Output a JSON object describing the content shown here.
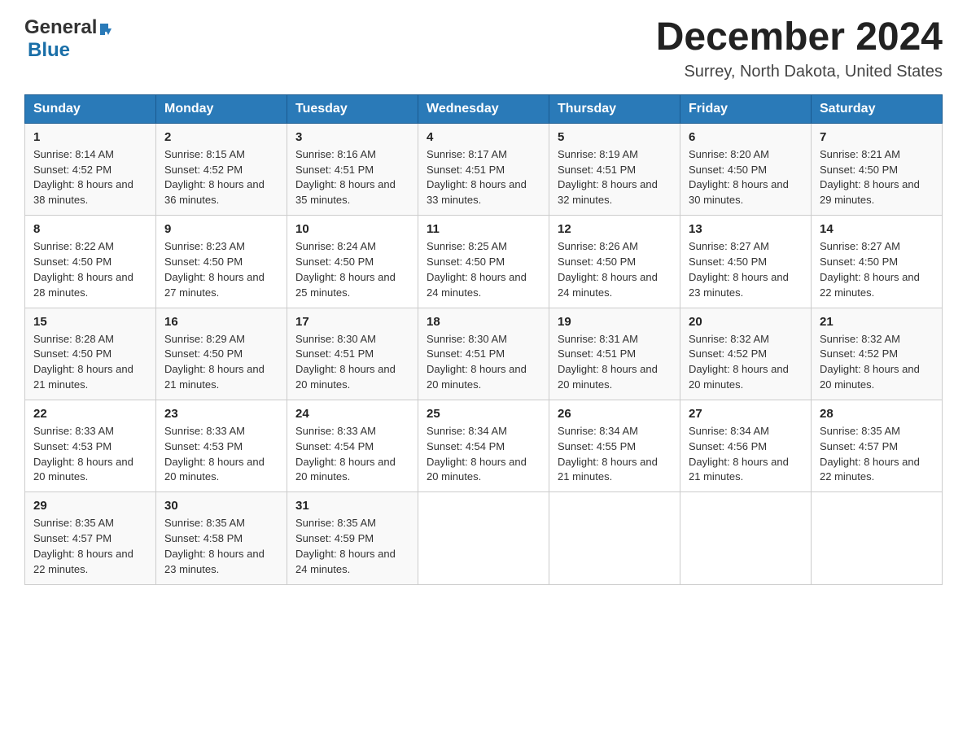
{
  "header": {
    "logo_general": "General",
    "logo_blue": "Blue",
    "month": "December 2024",
    "location": "Surrey, North Dakota, United States"
  },
  "days_of_week": [
    "Sunday",
    "Monday",
    "Tuesday",
    "Wednesday",
    "Thursday",
    "Friday",
    "Saturday"
  ],
  "weeks": [
    [
      {
        "day": "1",
        "sunrise": "8:14 AM",
        "sunset": "4:52 PM",
        "daylight": "8 hours and 38 minutes."
      },
      {
        "day": "2",
        "sunrise": "8:15 AM",
        "sunset": "4:52 PM",
        "daylight": "8 hours and 36 minutes."
      },
      {
        "day": "3",
        "sunrise": "8:16 AM",
        "sunset": "4:51 PM",
        "daylight": "8 hours and 35 minutes."
      },
      {
        "day": "4",
        "sunrise": "8:17 AM",
        "sunset": "4:51 PM",
        "daylight": "8 hours and 33 minutes."
      },
      {
        "day": "5",
        "sunrise": "8:19 AM",
        "sunset": "4:51 PM",
        "daylight": "8 hours and 32 minutes."
      },
      {
        "day": "6",
        "sunrise": "8:20 AM",
        "sunset": "4:50 PM",
        "daylight": "8 hours and 30 minutes."
      },
      {
        "day": "7",
        "sunrise": "8:21 AM",
        "sunset": "4:50 PM",
        "daylight": "8 hours and 29 minutes."
      }
    ],
    [
      {
        "day": "8",
        "sunrise": "8:22 AM",
        "sunset": "4:50 PM",
        "daylight": "8 hours and 28 minutes."
      },
      {
        "day": "9",
        "sunrise": "8:23 AM",
        "sunset": "4:50 PM",
        "daylight": "8 hours and 27 minutes."
      },
      {
        "day": "10",
        "sunrise": "8:24 AM",
        "sunset": "4:50 PM",
        "daylight": "8 hours and 25 minutes."
      },
      {
        "day": "11",
        "sunrise": "8:25 AM",
        "sunset": "4:50 PM",
        "daylight": "8 hours and 24 minutes."
      },
      {
        "day": "12",
        "sunrise": "8:26 AM",
        "sunset": "4:50 PM",
        "daylight": "8 hours and 24 minutes."
      },
      {
        "day": "13",
        "sunrise": "8:27 AM",
        "sunset": "4:50 PM",
        "daylight": "8 hours and 23 minutes."
      },
      {
        "day": "14",
        "sunrise": "8:27 AM",
        "sunset": "4:50 PM",
        "daylight": "8 hours and 22 minutes."
      }
    ],
    [
      {
        "day": "15",
        "sunrise": "8:28 AM",
        "sunset": "4:50 PM",
        "daylight": "8 hours and 21 minutes."
      },
      {
        "day": "16",
        "sunrise": "8:29 AM",
        "sunset": "4:50 PM",
        "daylight": "8 hours and 21 minutes."
      },
      {
        "day": "17",
        "sunrise": "8:30 AM",
        "sunset": "4:51 PM",
        "daylight": "8 hours and 20 minutes."
      },
      {
        "day": "18",
        "sunrise": "8:30 AM",
        "sunset": "4:51 PM",
        "daylight": "8 hours and 20 minutes."
      },
      {
        "day": "19",
        "sunrise": "8:31 AM",
        "sunset": "4:51 PM",
        "daylight": "8 hours and 20 minutes."
      },
      {
        "day": "20",
        "sunrise": "8:32 AM",
        "sunset": "4:52 PM",
        "daylight": "8 hours and 20 minutes."
      },
      {
        "day": "21",
        "sunrise": "8:32 AM",
        "sunset": "4:52 PM",
        "daylight": "8 hours and 20 minutes."
      }
    ],
    [
      {
        "day": "22",
        "sunrise": "8:33 AM",
        "sunset": "4:53 PM",
        "daylight": "8 hours and 20 minutes."
      },
      {
        "day": "23",
        "sunrise": "8:33 AM",
        "sunset": "4:53 PM",
        "daylight": "8 hours and 20 minutes."
      },
      {
        "day": "24",
        "sunrise": "8:33 AM",
        "sunset": "4:54 PM",
        "daylight": "8 hours and 20 minutes."
      },
      {
        "day": "25",
        "sunrise": "8:34 AM",
        "sunset": "4:54 PM",
        "daylight": "8 hours and 20 minutes."
      },
      {
        "day": "26",
        "sunrise": "8:34 AM",
        "sunset": "4:55 PM",
        "daylight": "8 hours and 21 minutes."
      },
      {
        "day": "27",
        "sunrise": "8:34 AM",
        "sunset": "4:56 PM",
        "daylight": "8 hours and 21 minutes."
      },
      {
        "day": "28",
        "sunrise": "8:35 AM",
        "sunset": "4:57 PM",
        "daylight": "8 hours and 22 minutes."
      }
    ],
    [
      {
        "day": "29",
        "sunrise": "8:35 AM",
        "sunset": "4:57 PM",
        "daylight": "8 hours and 22 minutes."
      },
      {
        "day": "30",
        "sunrise": "8:35 AM",
        "sunset": "4:58 PM",
        "daylight": "8 hours and 23 minutes."
      },
      {
        "day": "31",
        "sunrise": "8:35 AM",
        "sunset": "4:59 PM",
        "daylight": "8 hours and 24 minutes."
      },
      null,
      null,
      null,
      null
    ]
  ],
  "labels": {
    "sunrise": "Sunrise:",
    "sunset": "Sunset:",
    "daylight": "Daylight:"
  },
  "colors": {
    "header_bg": "#2a7ab8",
    "header_text": "#ffffff",
    "logo_blue": "#1a6fa8"
  }
}
